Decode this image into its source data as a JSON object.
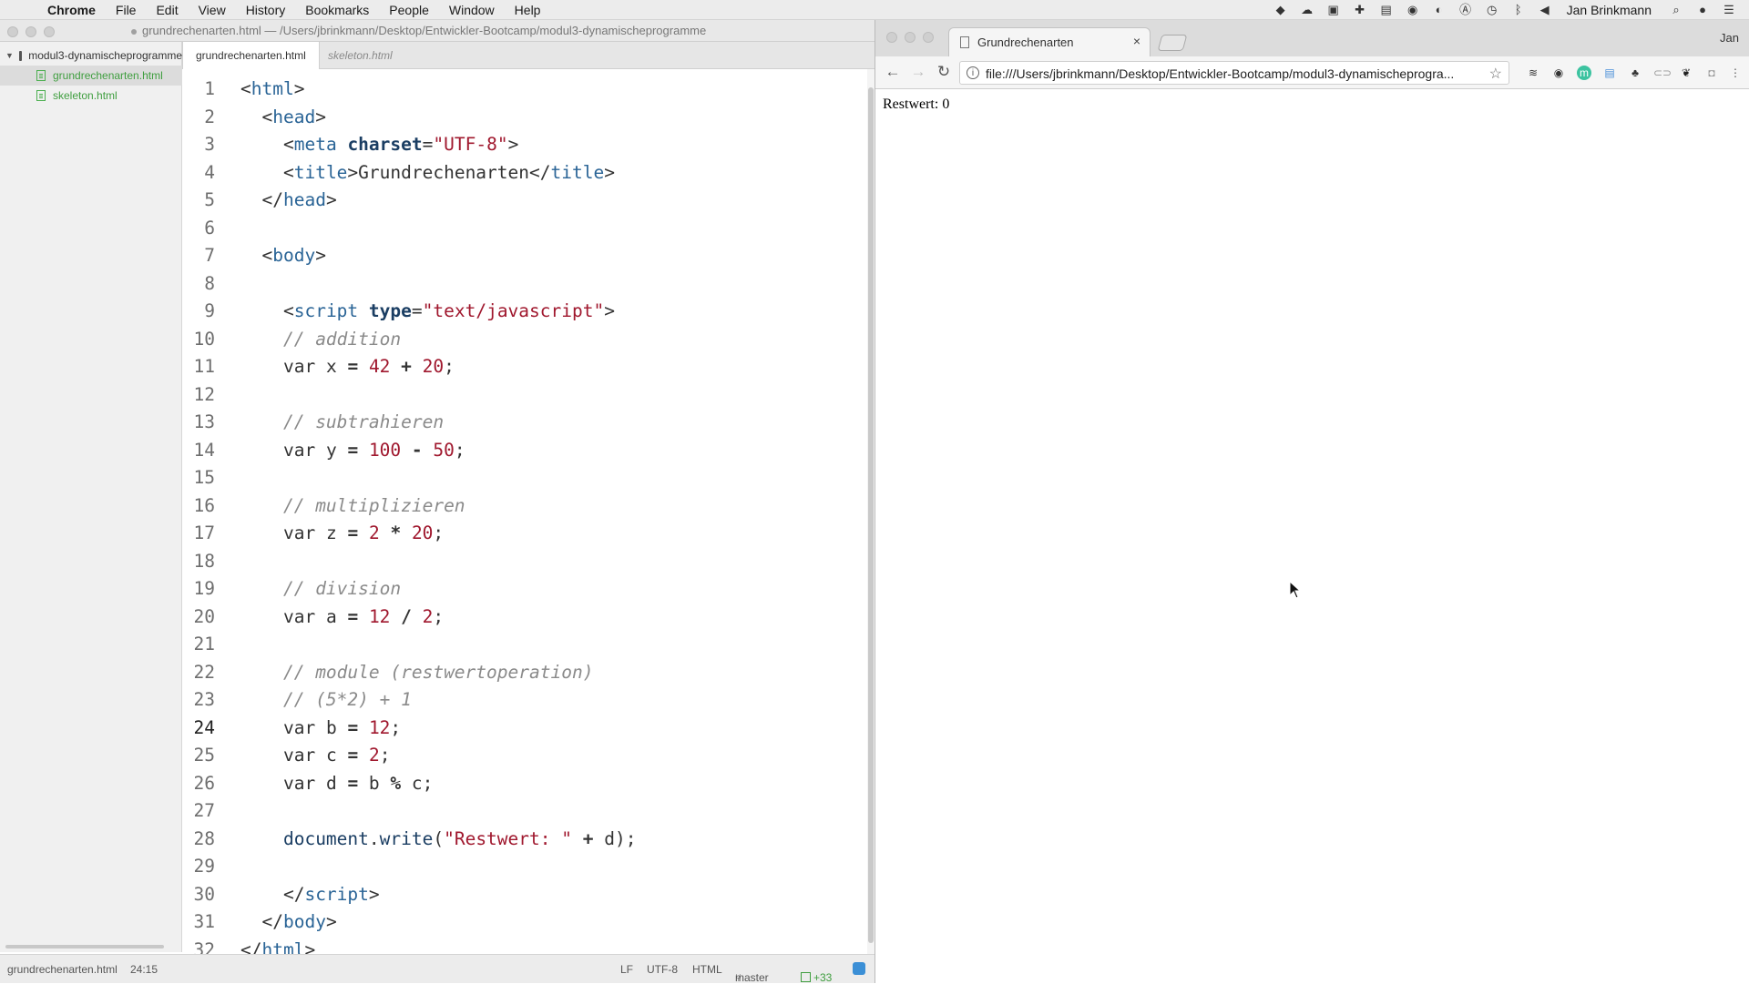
{
  "menubar": {
    "app_name": "Chrome",
    "items": [
      "File",
      "Edit",
      "View",
      "History",
      "Bookmarks",
      "People",
      "Window",
      "Help"
    ],
    "user_name": "Jan Brinkmann"
  },
  "editor": {
    "window_title": "grundrechenarten.html — /Users/jbrinkmann/Desktop/Entwickler-Bootcamp/modul3-dynamischeprogramme",
    "tree": {
      "root": "modul3-dynamischeprogramme",
      "files": [
        "grundrechenarten.html",
        "skeleton.html"
      ]
    },
    "tabs": [
      "grundrechenarten.html",
      "skeleton.html"
    ],
    "current_line": 24,
    "lines": [
      [
        [
          "tag",
          "<"
        ],
        [
          "tagname",
          "html"
        ],
        [
          "tag",
          ">"
        ]
      ],
      [
        [
          "p",
          "  "
        ],
        [
          "tag",
          "<"
        ],
        [
          "tagname",
          "head"
        ],
        [
          "tag",
          ">"
        ]
      ],
      [
        [
          "p",
          "    "
        ],
        [
          "tag",
          "<"
        ],
        [
          "tagname",
          "meta"
        ],
        [
          "p",
          " "
        ],
        [
          "attr",
          "charset"
        ],
        [
          "tag",
          "="
        ],
        [
          "str",
          "\"UTF-8\""
        ],
        [
          "tag",
          ">"
        ]
      ],
      [
        [
          "p",
          "    "
        ],
        [
          "tag",
          "<"
        ],
        [
          "tagname",
          "title"
        ],
        [
          "tag",
          ">"
        ],
        [
          "p",
          "Grundrechenarten"
        ],
        [
          "tag",
          "</"
        ],
        [
          "tagname",
          "title"
        ],
        [
          "tag",
          ">"
        ]
      ],
      [
        [
          "p",
          "  "
        ],
        [
          "tag",
          "</"
        ],
        [
          "tagname",
          "head"
        ],
        [
          "tag",
          ">"
        ]
      ],
      [],
      [
        [
          "p",
          "  "
        ],
        [
          "tag",
          "<"
        ],
        [
          "tagname",
          "body"
        ],
        [
          "tag",
          ">"
        ]
      ],
      [],
      [
        [
          "p",
          "    "
        ],
        [
          "tag",
          "<"
        ],
        [
          "tagname",
          "script"
        ],
        [
          "p",
          " "
        ],
        [
          "attr",
          "type"
        ],
        [
          "tag",
          "="
        ],
        [
          "str",
          "\"text/javascript\""
        ],
        [
          "tag",
          ">"
        ]
      ],
      [
        [
          "p",
          "    "
        ],
        [
          "cmt",
          "// addition"
        ]
      ],
      [
        [
          "p",
          "    "
        ],
        [
          "kw",
          "var"
        ],
        [
          "p",
          " x "
        ],
        [
          "op",
          "="
        ],
        [
          "p",
          " "
        ],
        [
          "num",
          "42"
        ],
        [
          "p",
          " "
        ],
        [
          "op",
          "+"
        ],
        [
          "p",
          " "
        ],
        [
          "num",
          "20"
        ],
        [
          "p",
          ";"
        ]
      ],
      [],
      [
        [
          "p",
          "    "
        ],
        [
          "cmt",
          "// subtrahieren"
        ]
      ],
      [
        [
          "p",
          "    "
        ],
        [
          "kw",
          "var"
        ],
        [
          "p",
          " y "
        ],
        [
          "op",
          "="
        ],
        [
          "p",
          " "
        ],
        [
          "num",
          "100"
        ],
        [
          "p",
          " "
        ],
        [
          "op",
          "-"
        ],
        [
          "p",
          " "
        ],
        [
          "num",
          "50"
        ],
        [
          "p",
          ";"
        ]
      ],
      [],
      [
        [
          "p",
          "    "
        ],
        [
          "cmt",
          "// multiplizieren"
        ]
      ],
      [
        [
          "p",
          "    "
        ],
        [
          "kw",
          "var"
        ],
        [
          "p",
          " z "
        ],
        [
          "op",
          "="
        ],
        [
          "p",
          " "
        ],
        [
          "num",
          "2"
        ],
        [
          "p",
          " "
        ],
        [
          "op",
          "*"
        ],
        [
          "p",
          " "
        ],
        [
          "num",
          "20"
        ],
        [
          "p",
          ";"
        ]
      ],
      [],
      [
        [
          "p",
          "    "
        ],
        [
          "cmt",
          "// division"
        ]
      ],
      [
        [
          "p",
          "    "
        ],
        [
          "kw",
          "var"
        ],
        [
          "p",
          " a "
        ],
        [
          "op",
          "="
        ],
        [
          "p",
          " "
        ],
        [
          "num",
          "12"
        ],
        [
          "p",
          " "
        ],
        [
          "op",
          "/"
        ],
        [
          "p",
          " "
        ],
        [
          "num",
          "2"
        ],
        [
          "p",
          ";"
        ]
      ],
      [],
      [
        [
          "p",
          "    "
        ],
        [
          "cmt",
          "// module (restwertoperation)"
        ]
      ],
      [
        [
          "p",
          "    "
        ],
        [
          "cmt",
          "// (5*2) + 1"
        ]
      ],
      [
        [
          "p",
          "    "
        ],
        [
          "kw",
          "var"
        ],
        [
          "p",
          " b "
        ],
        [
          "op",
          "="
        ],
        [
          "p",
          " "
        ],
        [
          "num",
          "12"
        ],
        [
          "p",
          ";"
        ]
      ],
      [
        [
          "p",
          "    "
        ],
        [
          "kw",
          "var"
        ],
        [
          "p",
          " c "
        ],
        [
          "op",
          "="
        ],
        [
          "p",
          " "
        ],
        [
          "num",
          "2"
        ],
        [
          "p",
          ";"
        ]
      ],
      [
        [
          "p",
          "    "
        ],
        [
          "kw",
          "var"
        ],
        [
          "p",
          " d "
        ],
        [
          "op",
          "="
        ],
        [
          "p",
          " b "
        ],
        [
          "op",
          "%"
        ],
        [
          "p",
          " c;"
        ]
      ],
      [],
      [
        [
          "p",
          "    "
        ],
        [
          "fn",
          "document"
        ],
        [
          "p",
          "."
        ],
        [
          "fn",
          "write"
        ],
        [
          "p",
          "("
        ],
        [
          "str",
          "\"Restwert: \""
        ],
        [
          "p",
          " "
        ],
        [
          "op",
          "+"
        ],
        [
          "p",
          " d);"
        ]
      ],
      [],
      [
        [
          "p",
          "    "
        ],
        [
          "tag",
          "</"
        ],
        [
          "tagname",
          "script"
        ],
        [
          "tag",
          ">"
        ]
      ],
      [
        [
          "p",
          "  "
        ],
        [
          "tag",
          "</"
        ],
        [
          "tagname",
          "body"
        ],
        [
          "tag",
          ">"
        ]
      ],
      [
        [
          "tag",
          "</"
        ],
        [
          "tagname",
          "html"
        ],
        [
          "tag",
          ">"
        ]
      ]
    ],
    "status": {
      "file": "grundrechenarten.html",
      "cursor": "24:15",
      "line_ending": "LF",
      "encoding": "UTF-8",
      "grammar": "HTML",
      "branch": "master",
      "diff": "+33"
    }
  },
  "browser": {
    "tab_title": "Grundrechenarten",
    "profile": "Jan",
    "url": "file:///Users/jbrinkmann/Desktop/Entwickler-Bootcamp/modul3-dynamischeprogra...",
    "page_output": "Restwert: 0"
  }
}
